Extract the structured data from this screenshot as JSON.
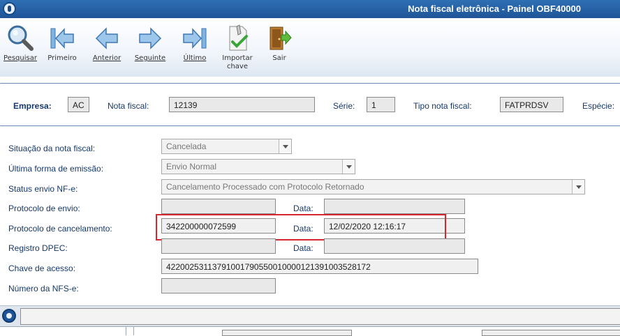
{
  "window": {
    "title": "Nota fiscal eletrônica - Painel OBF40000"
  },
  "toolbar": {
    "pesquisar": "Pesquisar",
    "primeiro": "Primeiro",
    "anterior": "Anterior",
    "seguinte": "Seguinte",
    "ultimo": "Último",
    "importar_line1": "Importar",
    "importar_line2": "chave",
    "sair": "Sair"
  },
  "header": {
    "empresa_label": "Empresa:",
    "empresa_value": "AC",
    "nota_label": "Nota fiscal:",
    "nota_value": "12139",
    "serie_label": "Série:",
    "serie_value": "1",
    "tipo_label": "Tipo nota fiscal:",
    "tipo_value": "FATPRDSV",
    "especie_label": "Espécie:"
  },
  "form": {
    "situacao_label": "Situação da nota fiscal:",
    "situacao_value": "Cancelada",
    "forma_label": "Última forma de emissão:",
    "forma_value": "Envio Normal",
    "status_label": "Status envio NF-e:",
    "status_value": "Cancelamento Processado com Protocolo Retornado",
    "protocolo_envio_label": "Protocolo de envio:",
    "data_label": "Data:",
    "protocolo_cancel_label": "Protocolo de cancelamento:",
    "protocolo_cancel_value": "342200000072599",
    "protocolo_cancel_data": "12/02/2020 12:16:17",
    "dpec_label": "Registro DPEC:",
    "chave_label": "Chave de acesso:",
    "chave_value": "42200253113791001790550010000121391003528172",
    "nfse_label": "Número da NFS-e:"
  }
}
